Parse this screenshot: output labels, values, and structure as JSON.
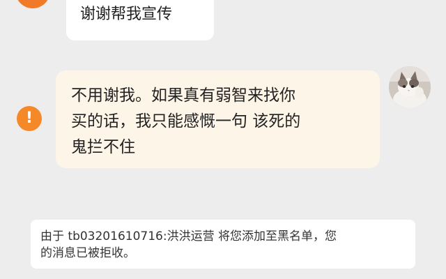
{
  "conversation": {
    "peer": {
      "avatar_color": "#f07a2a"
    },
    "messages": [
      {
        "direction": "incoming",
        "text": "谢谢帮我宣传"
      },
      {
        "direction": "outgoing",
        "status": "failed",
        "lines": [
          "不用谢我。如果真有弱智来找你",
          "买的话，我只能感慨一句 该死的",
          "鬼拦不住"
        ],
        "bubble_color": "#fdf5e8"
      }
    ],
    "failed_icon": {
      "name": "exclamation-icon",
      "symbol": "!",
      "color": "#f5892a"
    },
    "self": {
      "avatar": "cat-photo"
    }
  },
  "system_notice": {
    "lines": [
      "由于 tb03201610716:洪洪运营 将您添加至黑名单，您",
      "的消息已被拒收。"
    ]
  }
}
